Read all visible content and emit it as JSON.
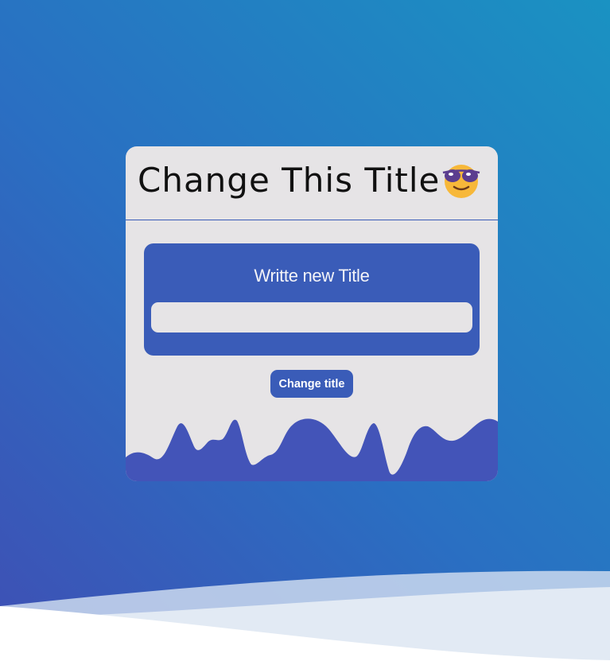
{
  "card": {
    "title": "Change This Title",
    "title_emoji": "smiling-face-with-sunglasses-icon",
    "input_label": "Writte new Title",
    "input_value": "",
    "input_placeholder": "",
    "button_label": "Change title"
  },
  "colors": {
    "background_start": "#3f4fb4",
    "background_end": "#1a92c2",
    "card_background": "#e6e4e6",
    "accent": "#3a5cb8",
    "card_wave": "#4354b8"
  }
}
